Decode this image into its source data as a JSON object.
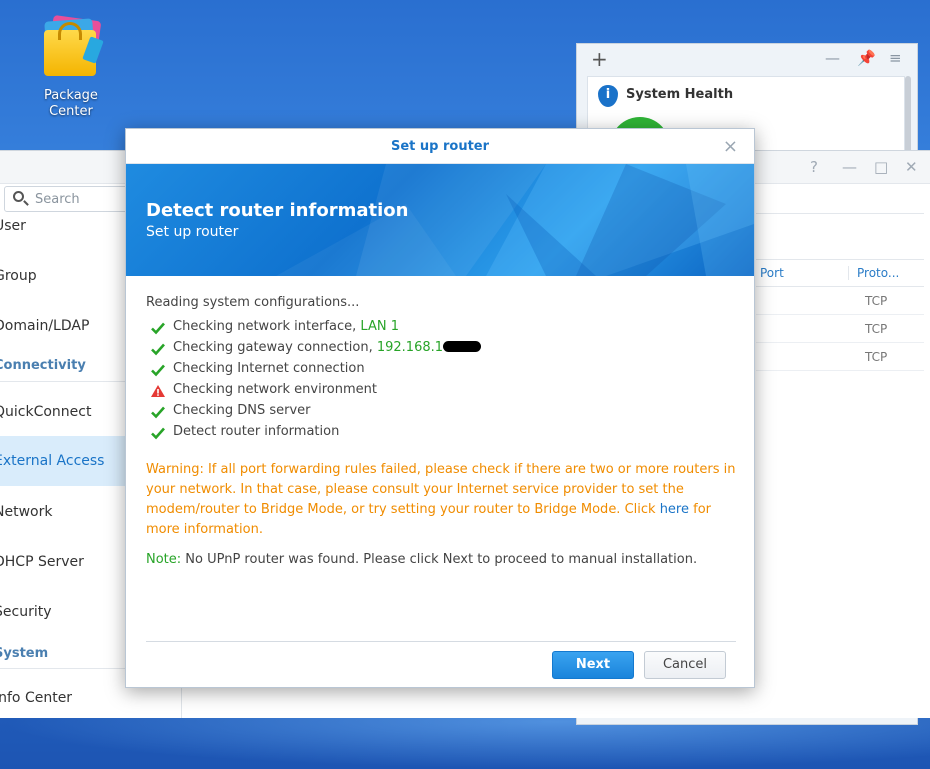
{
  "desktop": {
    "icon_label_line1": "Package",
    "icon_label_line2": "Center"
  },
  "widget": {
    "add_label": "+",
    "title": "System Health"
  },
  "control_panel": {
    "search_placeholder": "Search",
    "sidebar": {
      "items": [
        {
          "label": "User"
        },
        {
          "label": "Group"
        },
        {
          "label": "Domain/LDAP"
        },
        {
          "section": "Connectivity"
        },
        {
          "label": "QuickConnect"
        },
        {
          "label": "External Access",
          "active": true
        },
        {
          "label": "Network"
        },
        {
          "label": "DHCP Server"
        },
        {
          "label": "Security"
        },
        {
          "section": "System"
        },
        {
          "label": "Info Center"
        }
      ]
    },
    "table": {
      "columns": [
        "Port",
        "Proto..."
      ],
      "rows": [
        "TCP",
        "TCP",
        "TCP"
      ]
    }
  },
  "dialog": {
    "title": "Set up router",
    "close_label": "×",
    "banner_title": "Detect router information",
    "banner_subtitle": "Set up router",
    "reading_text": "Reading system configurations...",
    "checks": [
      {
        "status": "ok",
        "text": "Checking network interface, ",
        "value": "LAN 1"
      },
      {
        "status": "ok",
        "text": "Checking gateway connection, ",
        "value": "192.168.1"
      },
      {
        "status": "ok",
        "text": "Checking Internet connection",
        "value": ""
      },
      {
        "status": "warning",
        "text": "Checking network environment",
        "value": ""
      },
      {
        "status": "ok",
        "text": "Checking DNS server",
        "value": ""
      },
      {
        "status": "ok",
        "text": "Detect router information",
        "value": ""
      }
    ],
    "warning_text_1": "Warning: If all port forwarding rules failed, please check if there are two or more routers in your network. In that case, please consult your Internet service provider to set the modem/router to Bridge Mode, or try setting your router to Bridge Mode. Click ",
    "warning_link": "here",
    "warning_text_2": " for more information.",
    "note_label": "Note:",
    "note_text": " No UPnP router was found. Please click Next to proceed to manual installation.",
    "next_label": "Next",
    "cancel_label": "Cancel"
  },
  "colors": {
    "accent": "#1a74c7",
    "ok": "#28a428",
    "warning": "#f08c00",
    "error": "#e53935"
  }
}
